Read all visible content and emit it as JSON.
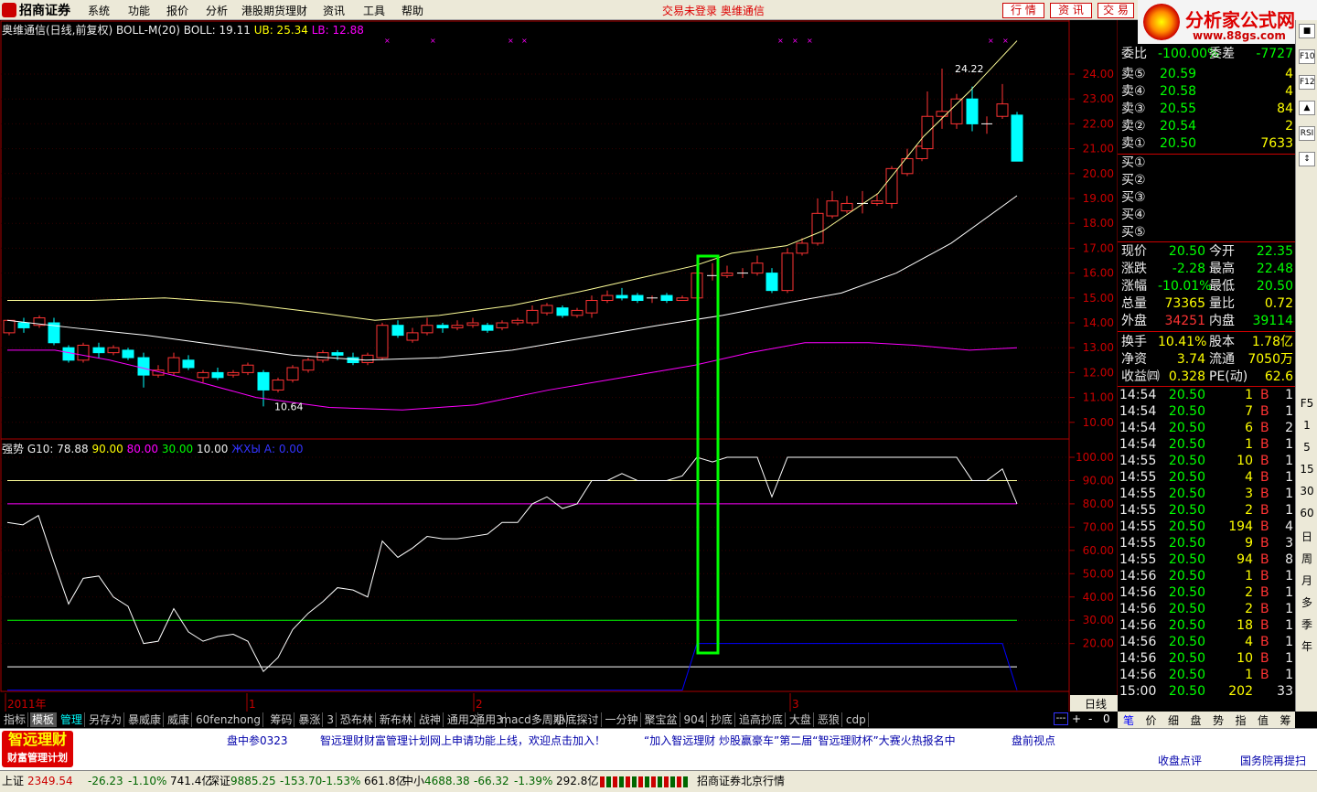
{
  "menubar": {
    "brand": "招商证券",
    "items": [
      "系统",
      "功能",
      "报价",
      "分析",
      "港股期货理财",
      "资讯",
      "工具",
      "帮助"
    ],
    "status_msg": "交易未登录  奥维通信",
    "btns": [
      "行 情",
      "资 讯",
      "交 易"
    ]
  },
  "brandad": {
    "title": "分析家公式网",
    "url": "www.88gs.com"
  },
  "chart": {
    "info": {
      "name": "奥维通信(日线,前复权)",
      "ind": "BOLL-M(20)",
      "boll": "BOLL: 19.11",
      "ub": "UB: 25.34",
      "lb": "LB: 12.88"
    },
    "price_ticks": [
      "24.00",
      "23.00",
      "22.00",
      "21.00",
      "20.00",
      "19.00",
      "18.00",
      "17.00",
      "16.00",
      "15.00",
      "14.00",
      "13.00",
      "12.00",
      "11.00",
      "10.00"
    ],
    "high_label": "24.22",
    "low_label": "10.64"
  },
  "indicator": {
    "name": "强势",
    "g10": "G10: 78.88",
    "v1": "90.00",
    "v2": "80.00",
    "v3": "30.00",
    "v4": "10.00",
    "v5": "ЖХЫ А: 0.00",
    "ticks": [
      "100.00",
      "90.00",
      "80.00",
      "70.00",
      "60.00",
      "50.00",
      "40.00",
      "30.00",
      "20.00"
    ]
  },
  "x_axis": {
    "labels": [
      "2011年",
      "1",
      "2",
      "3"
    ],
    "period": "日线",
    "dots": "---"
  },
  "quote": {
    "weibi": "委比",
    "weibi_v": "-100.00%",
    "weicha": "委差",
    "weicha_v": "-7727",
    "sells": [
      {
        "l": "卖⑤",
        "p": "20.59",
        "v": "4"
      },
      {
        "l": "卖④",
        "p": "20.58",
        "v": "4"
      },
      {
        "l": "卖③",
        "p": "20.55",
        "v": "84"
      },
      {
        "l": "卖②",
        "p": "20.54",
        "v": "2"
      },
      {
        "l": "卖①",
        "p": "20.50",
        "v": "7633"
      }
    ],
    "buys": [
      "买①",
      "买②",
      "买③",
      "买④",
      "买⑤"
    ],
    "stats": [
      {
        "a": "现价",
        "av": "20.50",
        "b": "今开",
        "bv": "22.35"
      },
      {
        "a": "涨跌",
        "av": "-2.28",
        "b": "最高",
        "bv": "22.48"
      },
      {
        "a": "涨幅",
        "av": "-10.01%",
        "b": "最低",
        "bv": "20.50"
      },
      {
        "a": "总量",
        "av": "73365",
        "b": "量比",
        "bv": "0.72"
      },
      {
        "a": "外盘",
        "av": "34251",
        "b": "内盘",
        "bv": "39114"
      },
      {
        "a": "换手",
        "av": "10.41%",
        "b": "股本",
        "bv": "1.78亿"
      },
      {
        "a": "净资",
        "av": "3.74",
        "b": "流通",
        "bv": "7050万"
      },
      {
        "a": "收益㈣",
        "av": "0.328",
        "b": "PE(动)",
        "bv": "62.6"
      }
    ],
    "ticks": [
      {
        "t": "14:54",
        "p": "20.50",
        "v": "1",
        "s": "B",
        "n": "1"
      },
      {
        "t": "14:54",
        "p": "20.50",
        "v": "7",
        "s": "B",
        "n": "1"
      },
      {
        "t": "14:54",
        "p": "20.50",
        "v": "6",
        "s": "B",
        "n": "2"
      },
      {
        "t": "14:54",
        "p": "20.50",
        "v": "1",
        "s": "B",
        "n": "1"
      },
      {
        "t": "14:55",
        "p": "20.50",
        "v": "10",
        "s": "B",
        "n": "1"
      },
      {
        "t": "14:55",
        "p": "20.50",
        "v": "4",
        "s": "B",
        "n": "1"
      },
      {
        "t": "14:55",
        "p": "20.50",
        "v": "3",
        "s": "B",
        "n": "1"
      },
      {
        "t": "14:55",
        "p": "20.50",
        "v": "2",
        "s": "B",
        "n": "1"
      },
      {
        "t": "14:55",
        "p": "20.50",
        "v": "194",
        "s": "B",
        "n": "4"
      },
      {
        "t": "14:55",
        "p": "20.50",
        "v": "9",
        "s": "B",
        "n": "3"
      },
      {
        "t": "14:55",
        "p": "20.50",
        "v": "94",
        "s": "B",
        "n": "8"
      },
      {
        "t": "14:56",
        "p": "20.50",
        "v": "1",
        "s": "B",
        "n": "1"
      },
      {
        "t": "14:56",
        "p": "20.50",
        "v": "2",
        "s": "B",
        "n": "1"
      },
      {
        "t": "14:56",
        "p": "20.50",
        "v": "2",
        "s": "B",
        "n": "1"
      },
      {
        "t": "14:56",
        "p": "20.50",
        "v": "18",
        "s": "B",
        "n": "1"
      },
      {
        "t": "14:56",
        "p": "20.50",
        "v": "4",
        "s": "B",
        "n": "1"
      },
      {
        "t": "14:56",
        "p": "20.50",
        "v": "10",
        "s": "B",
        "n": "1"
      },
      {
        "t": "14:56",
        "p": "20.50",
        "v": "1",
        "s": "B",
        "n": "1"
      },
      {
        "t": "15:00",
        "p": "20.50",
        "v": "202",
        "s": "",
        "n": "33"
      }
    ]
  },
  "side": {
    "icons": [
      "■",
      "F10",
      "F12",
      "▲",
      "RSI",
      "↕",
      "F5",
      "1",
      "5",
      "15",
      "30",
      "60",
      "日",
      "周",
      "月",
      "多",
      "季",
      "年"
    ]
  },
  "tabs": [
    "指标",
    "模板",
    "管理",
    "另存为",
    "暴威康",
    "威康",
    "60fenzhong",
    "筹码",
    "暴涨",
    "3",
    "恐布林",
    "新布林",
    "战神",
    "通用2",
    "通用3",
    "macd多周期",
    "小底探讨",
    "一分钟",
    "聚宝盆",
    "904",
    "抄底",
    "追高抄底",
    "大盘",
    "恶狼",
    "cdp"
  ],
  "rtabs": [
    "笔",
    "价",
    "细",
    "盘",
    "势",
    "指",
    "值",
    "筹"
  ],
  "ads": {
    "logo1": "智远理财",
    "logo2": "财富管理计划",
    "a1": "盘中参0323",
    "a2": "智远理财财富管理计划网上申请功能上线，欢迎点击加入！",
    "a3": "“加入智远理财 炒股赢豪车”第二届“智远理财杯”大赛火热报名中",
    "a4": "盘前视点",
    "a5": "收盘点评",
    "a6": "国务院再提扫"
  },
  "status": {
    "sh": "上证",
    "sh_v": "2349.54",
    "sh_c": "-26.23",
    "sh_p": "-1.10%",
    "sh_a": "741.4亿",
    "sz": "深证",
    "sz_v": "9885.25",
    "sz_c": "-153.70",
    "sz_p": "-1.53%",
    "sz_a": "661.8亿",
    "zx": "中小",
    "zx_v": "4688.38",
    "zx_c": "-66.32",
    "zx_p": "-1.39%",
    "zx_a": "292.8亿",
    "broker": "招商证券北京行情"
  }
}
